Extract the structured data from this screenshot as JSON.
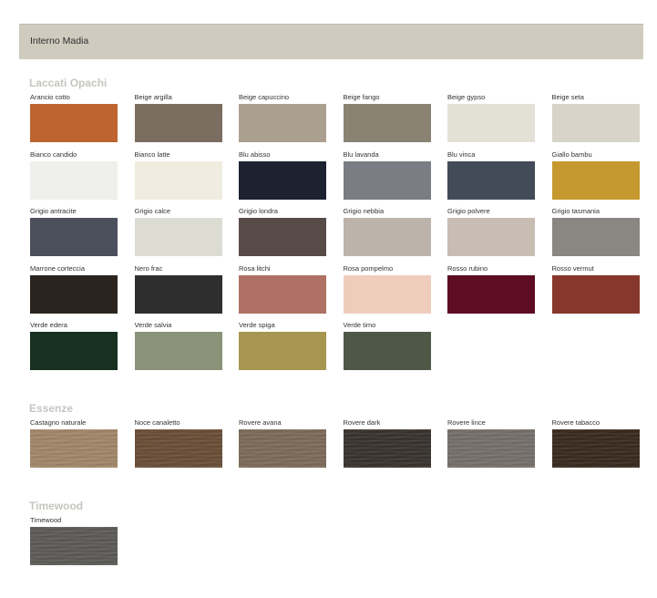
{
  "header": {
    "title": "Interno Madia"
  },
  "sections": [
    {
      "title": "Laccati Opachi",
      "swatches": [
        {
          "label": "Arancio cotto",
          "color": "#bd6431"
        },
        {
          "label": "Beige argilla",
          "color": "#7b6e60"
        },
        {
          "label": "Beige capuccino",
          "color": "#ab9f90"
        },
        {
          "label": "Beige fango",
          "color": "#8a8373"
        },
        {
          "label": "Beige gypso",
          "color": "#e3e1d6"
        },
        {
          "label": "Beige seta",
          "color": "#d8d4ca"
        },
        {
          "label": "Bianco candido",
          "color": "#efefec"
        },
        {
          "label": "Bianco latte",
          "color": "#f0ecdf"
        },
        {
          "label": "Blu abisso",
          "color": "#1c2230"
        },
        {
          "label": "Blu lavanda",
          "color": "#7a7d83"
        },
        {
          "label": "Blu vinca",
          "color": "#434b58"
        },
        {
          "label": "Giallo bambu",
          "color": "#c5992f"
        },
        {
          "label": "Grigio antracite",
          "color": "#4c4f5c"
        },
        {
          "label": "Grigio calce",
          "color": "#dddcd3"
        },
        {
          "label": "Grigio londra",
          "color": "#574b48"
        },
        {
          "label": "Grigio nebbia",
          "color": "#bcb3ab"
        },
        {
          "label": "Grigio polvere",
          "color": "#c8bdb2"
        },
        {
          "label": "Grigio tasmania",
          "color": "#8a8682"
        },
        {
          "label": "Marrone corteccia",
          "color": "#2b241e"
        },
        {
          "label": "Nero frac",
          "color": "#2e2e2e"
        },
        {
          "label": "Rosa litchi",
          "color": "#ae7163"
        },
        {
          "label": "Rosa pompelmo",
          "color": "#efcdbd"
        },
        {
          "label": "Rosso rubino",
          "color": "#5e0b24"
        },
        {
          "label": "Rosso vermut",
          "color": "#87372b"
        },
        {
          "label": "Verde edera",
          "color": "#17301f"
        },
        {
          "label": "Verde salvia",
          "color": "#8a9278"
        },
        {
          "label": "Verde spiga",
          "color": "#a69650"
        },
        {
          "label": "Verde timo",
          "color": "#4f5746"
        }
      ]
    },
    {
      "title": "Essenze",
      "swatches": [
        {
          "label": "Castagno naturale",
          "color": "#a3876a"
        },
        {
          "label": "Noce canaletto",
          "color": "#6b4e37"
        },
        {
          "label": "Rovere avana",
          "color": "#7d6b59"
        },
        {
          "label": "Rovere dark",
          "color": "#38332f"
        },
        {
          "label": "Rovere lince",
          "color": "#75706c"
        },
        {
          "label": "Rovere tabacco",
          "color": "#3a2a1d"
        }
      ]
    },
    {
      "title": "Timewood",
      "swatches": [
        {
          "label": "Timewood",
          "color": "#5d5b57"
        }
      ]
    }
  ]
}
